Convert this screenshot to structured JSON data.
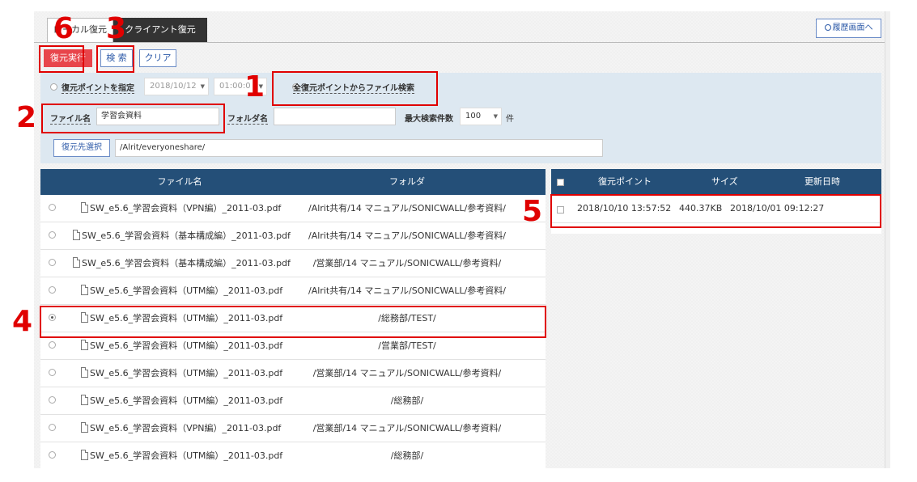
{
  "tabs": [
    {
      "label": "ローカル復元"
    },
    {
      "label": "クライアント復元"
    }
  ],
  "history_button": "履歴画面へ",
  "toolbar": {
    "restore_label": "復元実行",
    "search_label": "検 索",
    "clear_label": "クリア"
  },
  "search": {
    "restore_point_label": "復元ポイントを指定",
    "date_value": "2018/10/12",
    "time_value": "01:00:0",
    "all_points_label": "全復元ポイントからファイル検索",
    "filename_label": "ファイル名",
    "filename_value": "学習会資料",
    "folder_label": "フォルダ名",
    "folder_value": "",
    "max_label": "最大検索件数",
    "max_value": "100",
    "max_unit": "件",
    "dest_button": "復元先選択",
    "dest_value": "/Alrit/everyoneshare/"
  },
  "files_table": {
    "headers": {
      "file": "ファイル名",
      "folder": "フォルダ"
    },
    "rows": [
      {
        "file": "SW_e5.6_学習会資料（VPN編）_2011-03.pdf",
        "folder": "/Alrit共有/14 マニュアル/SONICWALL/参考資料/"
      },
      {
        "file": "SW_e5.6_学習会資料（基本構成編）_2011-03.pdf",
        "folder": "/Alrit共有/14 マニュアル/SONICWALL/参考資料/"
      },
      {
        "file": "SW_e5.6_学習会資料（基本構成編）_2011-03.pdf",
        "folder": "/営業部/14 マニュアル/SONICWALL/参考資料/"
      },
      {
        "file": "SW_e5.6_学習会資料（UTM編）_2011-03.pdf",
        "folder": "/Alrit共有/14 マニュアル/SONICWALL/参考資料/"
      },
      {
        "file": "SW_e5.6_学習会資料（UTM編）_2011-03.pdf",
        "folder": "/総務部/TEST/"
      },
      {
        "file": "SW_e5.6_学習会資料（UTM編）_2011-03.pdf",
        "folder": "/営業部/TEST/"
      },
      {
        "file": "SW_e5.6_学習会資料（UTM編）_2011-03.pdf",
        "folder": "/営業部/14 マニュアル/SONICWALL/参考資料/"
      },
      {
        "file": "SW_e5.6_学習会資料（UTM編）_2011-03.pdf",
        "folder": "/総務部/"
      },
      {
        "file": "SW_e5.6_学習会資料（VPN編）_2011-03.pdf",
        "folder": "/営業部/14 マニュアル/SONICWALL/参考資料/"
      },
      {
        "file": "SW_e5.6_学習会資料（UTM編）_2011-03.pdf",
        "folder": "/総務部/"
      }
    ]
  },
  "points_table": {
    "headers": {
      "point": "復元ポイント",
      "size": "サイズ",
      "updated": "更新日時"
    },
    "rows": [
      {
        "point": "2018/10/10 13:57:52",
        "size": "440.37KB",
        "updated": "2018/10/01 09:12:27"
      }
    ]
  },
  "annotations": [
    "6",
    "3",
    "1",
    "2",
    "4",
    "5"
  ],
  "colors": {
    "accent_red": "#e8454b",
    "header_navy": "#244f78",
    "panel_blue": "#dde8f1",
    "marker_red": "#e00000"
  }
}
